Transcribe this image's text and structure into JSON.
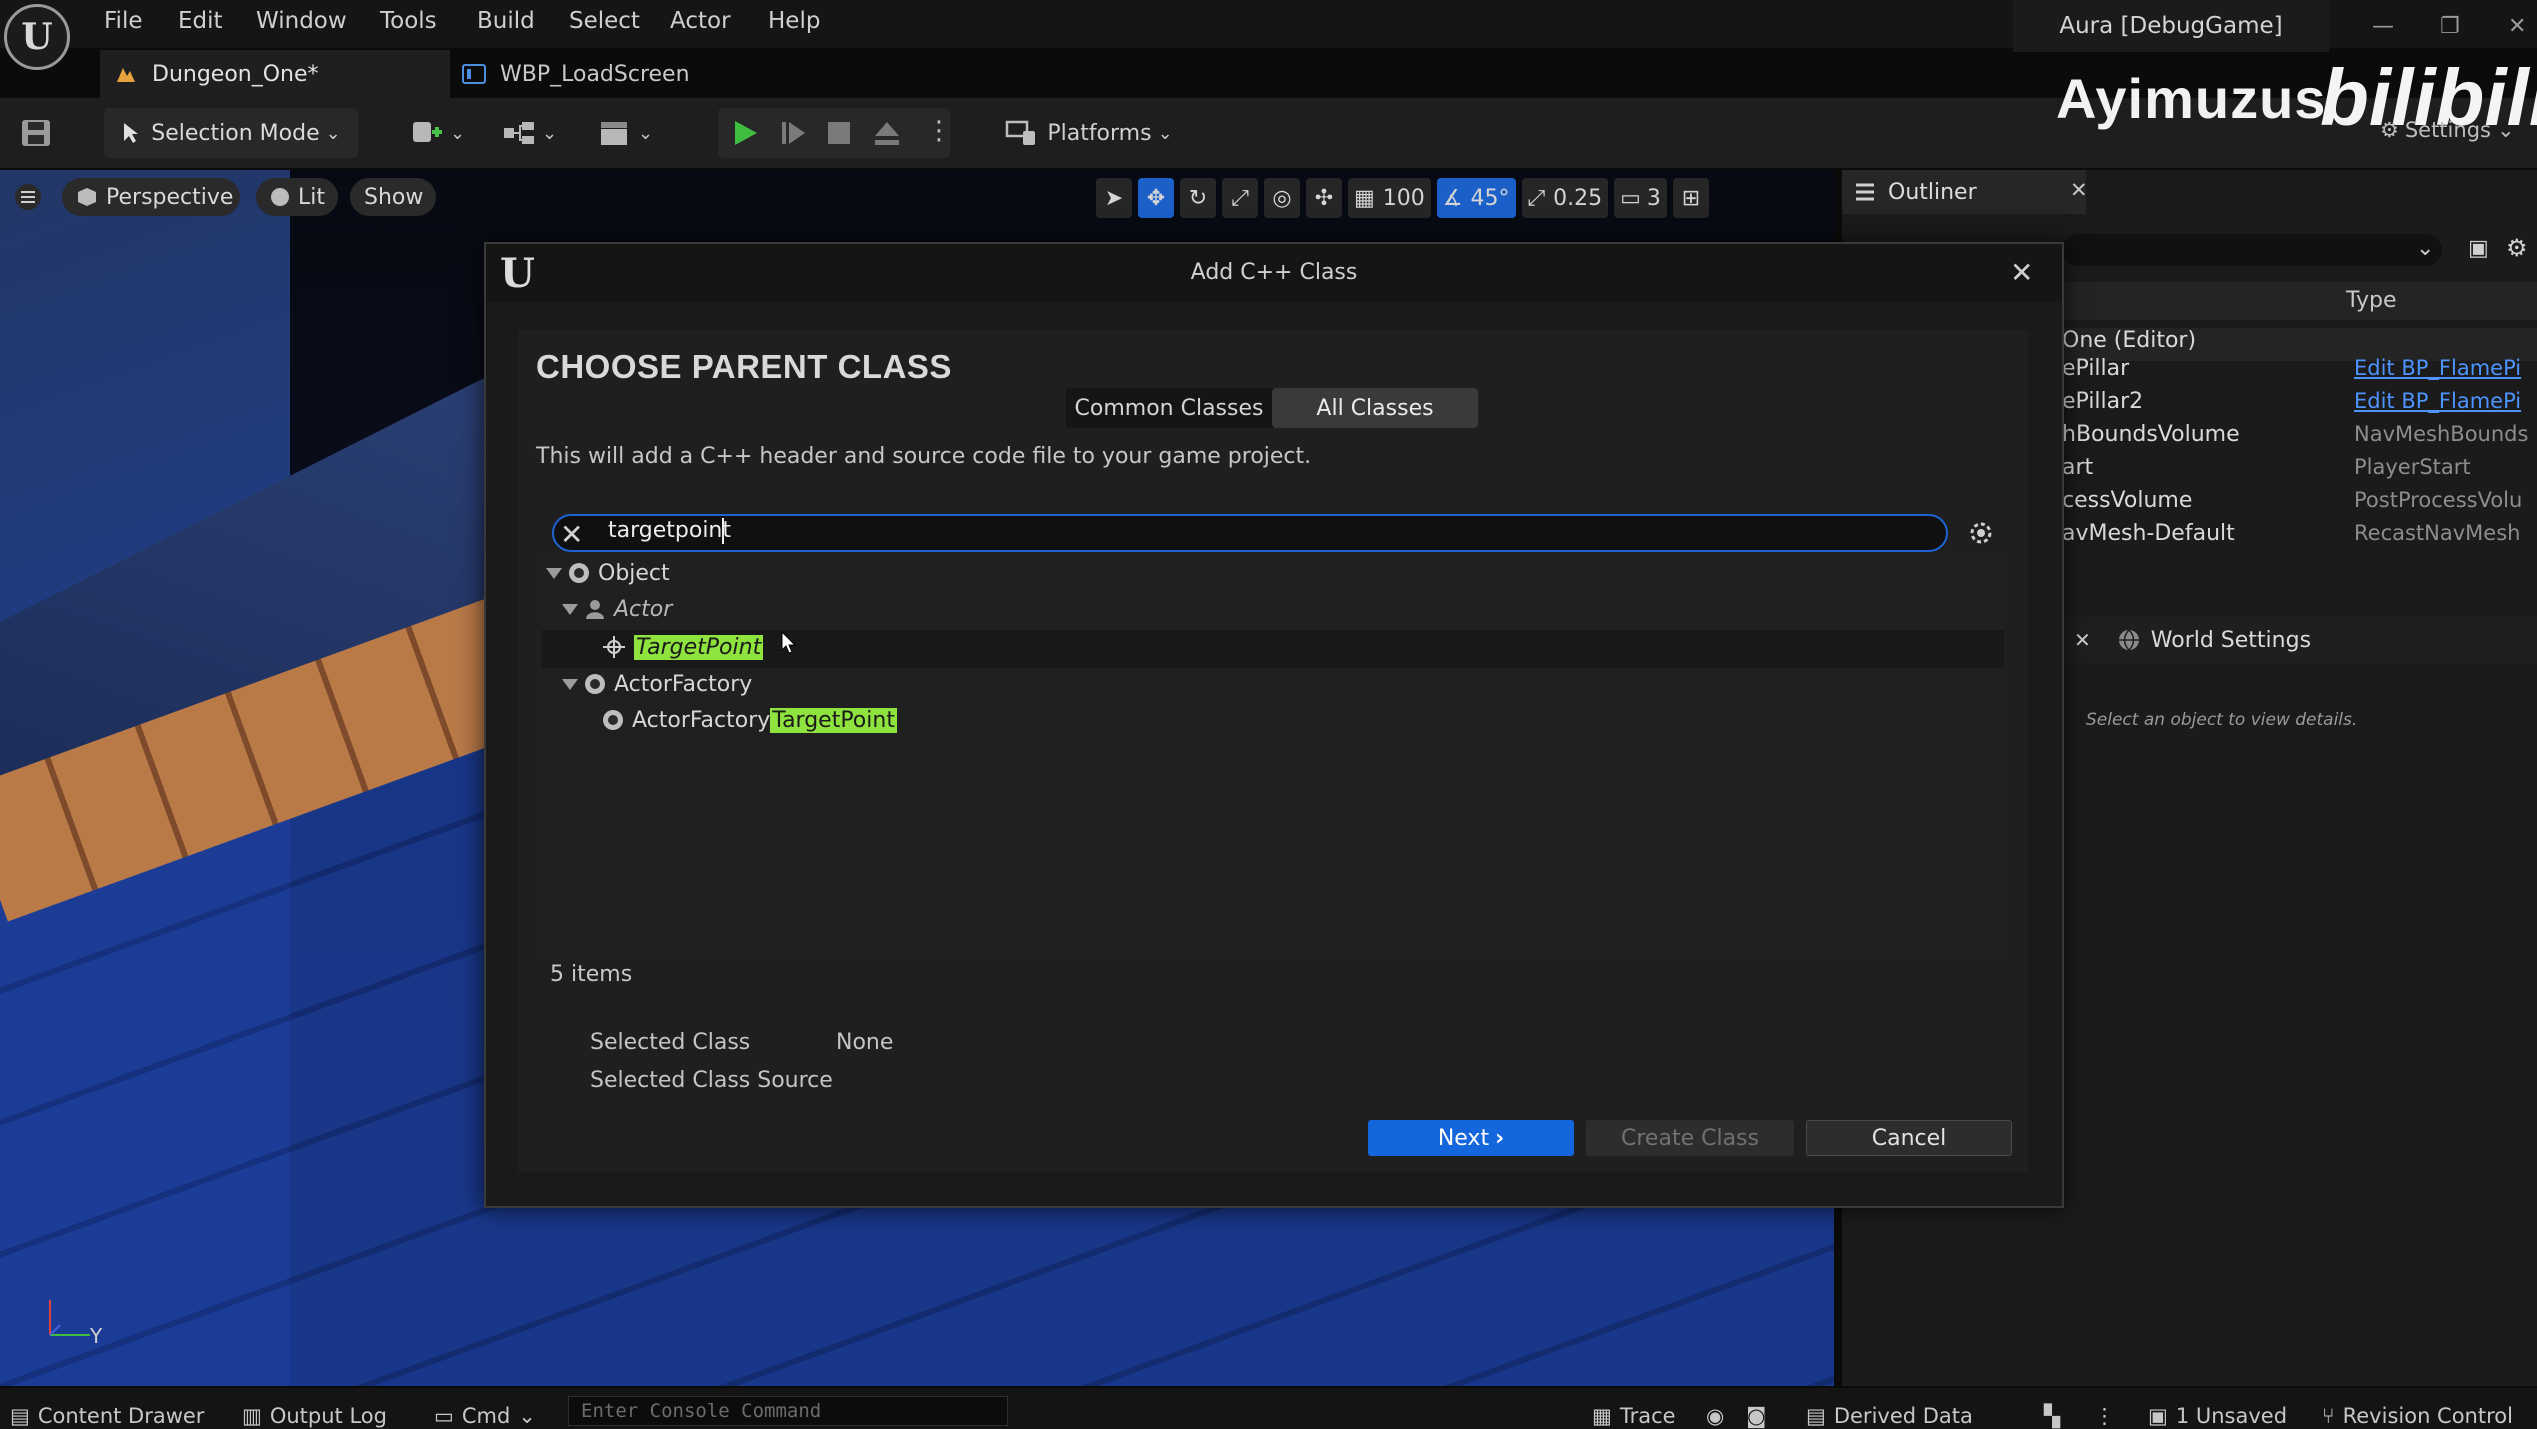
{
  "app": {
    "menu": [
      "File",
      "Edit",
      "Window",
      "Tools",
      "Build",
      "Select",
      "Actor",
      "Help"
    ],
    "window_title": "Aura [DebugGame]",
    "watermark": "Ayimuzus",
    "watermark_logo": "bilibili"
  },
  "tabs": [
    {
      "label": "Dungeon_One*",
      "icon": "level-icon"
    },
    {
      "label": "WBP_LoadScreen",
      "icon": "widget-blueprint-icon"
    }
  ],
  "toolbar": {
    "selection_mode": "Selection Mode",
    "platforms": "Platforms",
    "settings": "Settings"
  },
  "viewport": {
    "perspective": "Perspective",
    "lit": "Lit",
    "show": "Show",
    "grid_snap": "100",
    "rotation_snap": "45°",
    "scale_snap": "0.25",
    "camera_speed": "3",
    "axis_label": "Y"
  },
  "outliner": {
    "tab_label": "Outliner",
    "type_header": "Type",
    "rows": [
      {
        "name": "One (Editor)",
        "type": "",
        "link": false
      },
      {
        "name": "ePillar",
        "type": "Edit BP_FlamePi",
        "link": true
      },
      {
        "name": "ePillar2",
        "type": "Edit BP_FlamePi",
        "link": true
      },
      {
        "name": "hBoundsVolume",
        "type": "NavMeshBounds",
        "link": false
      },
      {
        "name": "art",
        "type": "PlayerStart",
        "link": false
      },
      {
        "name": "cessVolume",
        "type": "PostProcessVolu",
        "link": false
      },
      {
        "name": "avMesh-Default",
        "type": "RecastNavMesh",
        "link": false
      }
    ]
  },
  "details": {
    "world_settings": "World Settings",
    "hint": "Select an object to view details."
  },
  "dialog": {
    "title": "Add C++ Class",
    "heading": "CHOOSE PARENT CLASS",
    "tab_common": "Common Classes",
    "tab_all": "All Classes",
    "description": "This will add a C++ header and source code file to your game project.",
    "search_value": "targetpoint",
    "tree": {
      "object": "Object",
      "actor": "Actor",
      "target_point": "TargetPoint",
      "actor_factory": "ActorFactory",
      "actor_factory_prefix": "ActorFactory",
      "actor_factory_match": "TargetPoint"
    },
    "item_count": "5 items",
    "selected_class_label": "Selected Class",
    "selected_class_value": "None",
    "selected_class_source_label": "Selected Class Source",
    "next": "Next",
    "create_class": "Create Class",
    "cancel": "Cancel"
  },
  "statusbar": {
    "content_drawer": "Content Drawer",
    "output_log": "Output Log",
    "cmd": "Cmd",
    "console_placeholder": "Enter Console Command",
    "trace": "Trace",
    "derived_data": "Derived Data",
    "unsaved": "1 Unsaved",
    "revision_control": "Revision Control"
  },
  "colors": {
    "accent": "#1466dc",
    "search_highlight": "#8ee33e",
    "play_green": "#3fbf3f",
    "link_blue": "#4d94ff"
  }
}
